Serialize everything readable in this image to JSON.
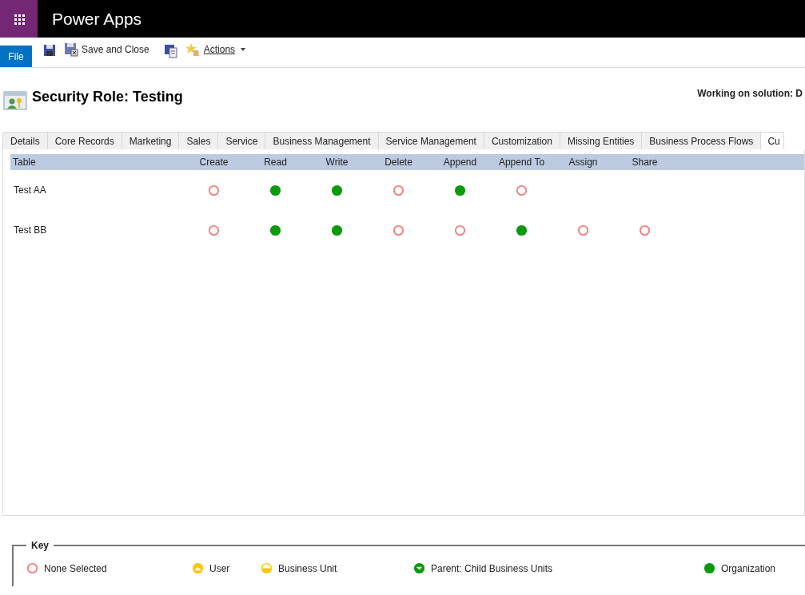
{
  "app_bar": {
    "title": "Power Apps"
  },
  "toolbar": {
    "file": "File",
    "save_close": "Save and Close",
    "actions": "Actions"
  },
  "header": {
    "title": "Security Role: Testing",
    "solution": "Working on solution: D"
  },
  "tabs": [
    {
      "label": "Details",
      "selected": false
    },
    {
      "label": "Core Records",
      "selected": false
    },
    {
      "label": "Marketing",
      "selected": false
    },
    {
      "label": "Sales",
      "selected": false
    },
    {
      "label": "Service",
      "selected": false
    },
    {
      "label": "Business Management",
      "selected": false
    },
    {
      "label": "Service Management",
      "selected": false
    },
    {
      "label": "Customization",
      "selected": false
    },
    {
      "label": "Missing Entities",
      "selected": false
    },
    {
      "label": "Business Process Flows",
      "selected": false
    },
    {
      "label": "Cu",
      "selected": true
    }
  ],
  "table": {
    "columns": [
      "Table",
      "Create",
      "Read",
      "Write",
      "Delete",
      "Append",
      "Append To",
      "Assign",
      "Share"
    ],
    "rows": [
      {
        "name": "Test AA",
        "cells": [
          {
            "kind": "none"
          },
          {
            "kind": "organization"
          },
          {
            "kind": "organization"
          },
          {
            "kind": "none"
          },
          {
            "kind": "organization"
          },
          {
            "kind": "none"
          }
        ]
      },
      {
        "name": "Test BB",
        "cells": [
          {
            "kind": "none"
          },
          {
            "kind": "organization"
          },
          {
            "kind": "organization"
          },
          {
            "kind": "none"
          },
          {
            "kind": "none"
          },
          {
            "kind": "organization"
          },
          {
            "kind": "none"
          },
          {
            "kind": "none"
          }
        ]
      }
    ]
  },
  "key": {
    "title": "Key",
    "items": [
      {
        "kind": "none",
        "label": "None Selected"
      },
      {
        "kind": "user",
        "label": "User"
      },
      {
        "kind": "business_unit",
        "label": "Business Unit"
      },
      {
        "kind": "parent_child",
        "label": "Parent: Child Business Units"
      },
      {
        "kind": "organization",
        "label": "Organization"
      }
    ]
  }
}
